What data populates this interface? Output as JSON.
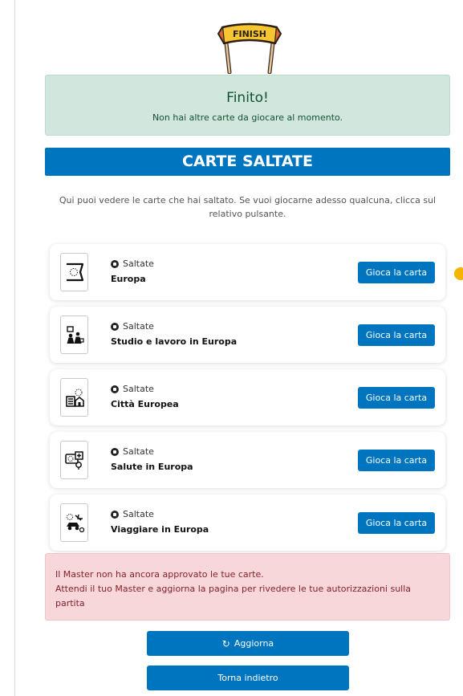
{
  "finish_banner": {
    "label": "FINISH"
  },
  "alert_success": {
    "title": "Finito!",
    "message": "Non hai altre carte da giocare al momento."
  },
  "section": {
    "title": "CARTE SALTATE",
    "intro": "Qui puoi vedere le carte che hai saltato. Se vuoi giocarne adesso qualcuna, clicca sul relativo pulsante."
  },
  "cards": [
    {
      "status": "Saltate",
      "name": "Europa",
      "button": "Gioca la carta",
      "icon": "eu-flag-icon"
    },
    {
      "status": "Saltate",
      "name": "Studio e lavoro in Europa",
      "button": "Gioca la carta",
      "icon": "study-work-icon"
    },
    {
      "status": "Saltate",
      "name": "Città Europea",
      "button": "Gioca la carta",
      "icon": "city-icon"
    },
    {
      "status": "Saltate",
      "name": "Salute in Europa",
      "button": "Gioca la carta",
      "icon": "health-card-icon"
    },
    {
      "status": "Saltate",
      "name": "Viaggiare in Europa",
      "button": "Gioca la carta",
      "icon": "travel-icon"
    }
  ],
  "alert_danger": {
    "line1": "Il Master non ha ancora approvato le tue carte.",
    "line2": "Attendi il tuo Master e aggiorna la pagina per rivedere le tue autorizzazioni sulla partita"
  },
  "buttons": {
    "refresh": "Aggiorna",
    "back": "Torna indietro"
  },
  "colors": {
    "primary": "#0075bf",
    "success_bg": "#d1e7dd",
    "danger_bg": "#f8d7da"
  }
}
